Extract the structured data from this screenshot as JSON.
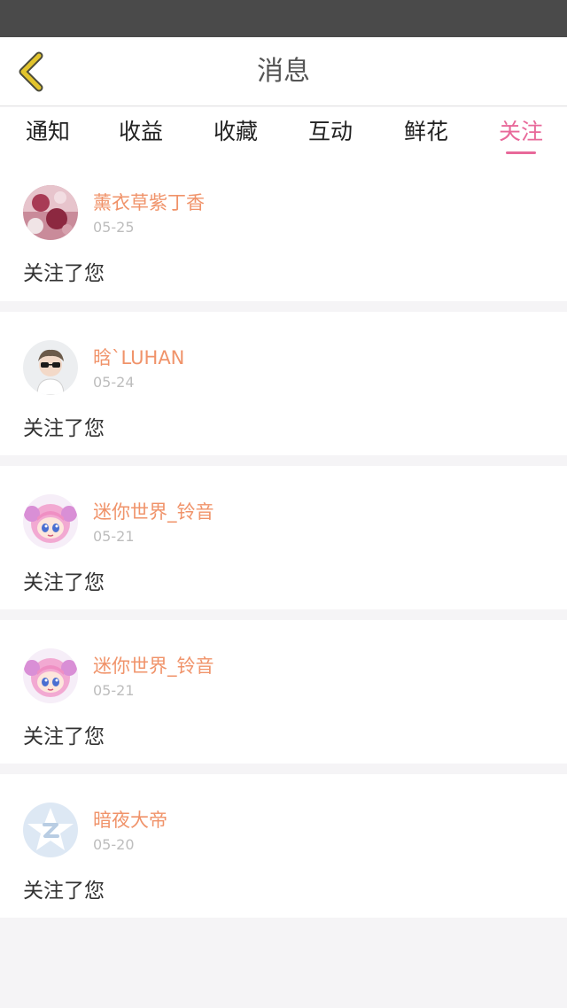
{
  "header": {
    "title": "消息"
  },
  "tabs": [
    {
      "label": "通知",
      "active": false
    },
    {
      "label": "收益",
      "active": false
    },
    {
      "label": "收藏",
      "active": false
    },
    {
      "label": "互动",
      "active": false
    },
    {
      "label": "鲜花",
      "active": false
    },
    {
      "label": "关注",
      "active": true
    }
  ],
  "colors": {
    "accent": "#e8699a",
    "username": "#f0936a",
    "back_icon": "#e2c42c"
  },
  "items": [
    {
      "username": "薰衣草紫丁香",
      "date": "05-25",
      "message": "关注了您",
      "avatar_icon": "floral-avatar"
    },
    {
      "username": "晗`LUHAN",
      "date": "05-24",
      "message": "关注了您",
      "avatar_icon": "person-sunglasses-avatar"
    },
    {
      "username": "迷你世界_铃音",
      "date": "05-21",
      "message": "关注了您",
      "avatar_icon": "anime-girl-avatar"
    },
    {
      "username": "迷你世界_铃音",
      "date": "05-21",
      "message": "关注了您",
      "avatar_icon": "anime-girl-avatar"
    },
    {
      "username": "暗夜大帝",
      "date": "05-20",
      "message": "关注了您",
      "avatar_icon": "default-z-avatar"
    }
  ]
}
